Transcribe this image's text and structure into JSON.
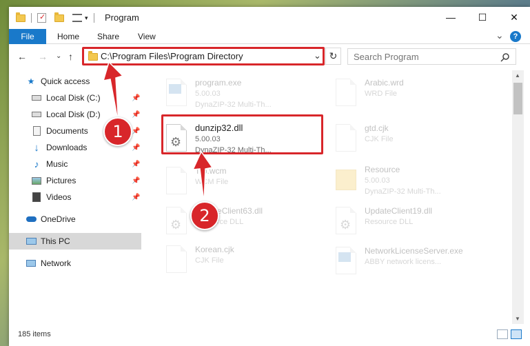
{
  "window": {
    "title": "Program",
    "minimize_glyph": "—",
    "maximize_glyph": "☐",
    "close_glyph": "✕"
  },
  "ribbon": {
    "tabs": [
      "File",
      "Home",
      "Share",
      "View"
    ],
    "expand_glyph": "⌄",
    "help_glyph": "?"
  },
  "address": {
    "path": "C:\\Program Files\\Program Directory",
    "dropdown_glyph": "⌄",
    "refresh_glyph": "↻"
  },
  "nav_glyphs": {
    "back": "←",
    "forward": "→",
    "recent": "⌄",
    "up": "↑"
  },
  "search": {
    "placeholder": "Search Program",
    "icon": "search-icon"
  },
  "sidebar": {
    "items": [
      {
        "label": "Quick access",
        "icon": "star-icon",
        "pinned": false
      },
      {
        "label": "Local Disk (C:)",
        "icon": "drive-icon",
        "pinned": true
      },
      {
        "label": "Local Disk (D:)",
        "icon": "drive-icon",
        "pinned": true
      },
      {
        "label": "Documents",
        "icon": "document-icon",
        "pinned": true
      },
      {
        "label": "Downloads",
        "icon": "download-icon",
        "pinned": true
      },
      {
        "label": "Music",
        "icon": "music-icon",
        "pinned": true
      },
      {
        "label": "Pictures",
        "icon": "pictures-icon",
        "pinned": true
      },
      {
        "label": "Videos",
        "icon": "video-icon",
        "pinned": true
      },
      {
        "label": "OneDrive",
        "icon": "cloud-icon",
        "pinned": false
      },
      {
        "label": "This PC",
        "icon": "computer-icon",
        "pinned": false,
        "selected": true
      },
      {
        "label": "Network",
        "icon": "network-icon",
        "pinned": false
      }
    ]
  },
  "files": [
    {
      "name": "program.exe",
      "line2": "5.00.03",
      "line3": "DynaZIP-32 Multi-Th...",
      "faded": true
    },
    {
      "name": "dunzip32.dll",
      "line2": "5.00.03",
      "line3": "DynaZIP-32 Multi-Th...",
      "faded": false,
      "highlighted": true
    },
    {
      "name": "Trb.wcm",
      "line2": "WCM File",
      "line3": "",
      "faded": true
    },
    {
      "name": "UpdateClient63.dll",
      "line2": "Resource DLL",
      "line3": "",
      "faded": true
    },
    {
      "name": "Korean.cjk",
      "line2": "CJK File",
      "line3": "",
      "faded": true
    },
    {
      "name": "Arabic.wrd",
      "line2": "WRD File",
      "line3": "",
      "faded": true
    },
    {
      "name": "gtd.cjk",
      "line2": "CJK File",
      "line3": "",
      "faded": true
    },
    {
      "name": "Resource",
      "line2": "5.00.03",
      "line3": "DynaZIP-32 Multi-Th...",
      "faded": true
    },
    {
      "name": "UpdateClient19.dll",
      "line2": "Resource DLL",
      "line3": "",
      "faded": true
    },
    {
      "name": "NetworkLicenseServer.exe",
      "line2": "ABBY network licens...",
      "line3": "",
      "faded": true
    }
  ],
  "status": {
    "item_count": "185 items"
  },
  "callouts": [
    {
      "number": "1"
    },
    {
      "number": "2"
    }
  ],
  "colors": {
    "accent": "#1979ca",
    "highlight_red": "#d8262a",
    "selection": "#d8d8d8"
  }
}
